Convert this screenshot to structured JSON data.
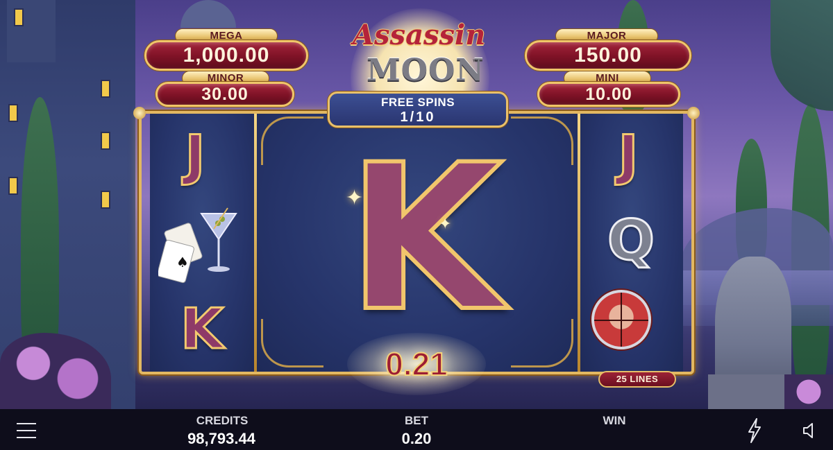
{
  "game": {
    "logo_line1": "Assassin",
    "logo_line2": "MOON",
    "logo_tm": "™"
  },
  "jackpots": {
    "mega": {
      "label": "MEGA",
      "value": "1,000.00"
    },
    "minor": {
      "label": "MINOR",
      "value": "30.00"
    },
    "major": {
      "label": "MAJOR",
      "value": "150.00"
    },
    "mini": {
      "label": "MINI",
      "value": "10.00"
    }
  },
  "free_spins": {
    "title": "FREE SPINS",
    "count": "1/10"
  },
  "reels": {
    "reel1": [
      "J",
      "martini-cards-icon",
      "K"
    ],
    "reel2_3_4": "K",
    "reel5": [
      "J",
      "Q",
      "assassin-target-icon"
    ]
  },
  "symbols": {
    "r1_top": "J",
    "r1_bottom": "K",
    "big": "K",
    "r5_top": "J",
    "r5_mid": "Q"
  },
  "win_amount": "0.21",
  "lines_badge": "25 LINES",
  "bottom_bar": {
    "credits_label": "CREDITS",
    "credits_value": "98,793.44",
    "bet_label": "BET",
    "bet_value": "0.20",
    "win_label": "WIN",
    "icons": [
      "menu-icon",
      "turbo-bolt-icon",
      "sound-icon"
    ]
  },
  "colors": {
    "jackpot_red": "#7e1226",
    "gold": "#e3b862",
    "reel_blue": "#26346a",
    "bar_bg": "#0c0c16"
  }
}
